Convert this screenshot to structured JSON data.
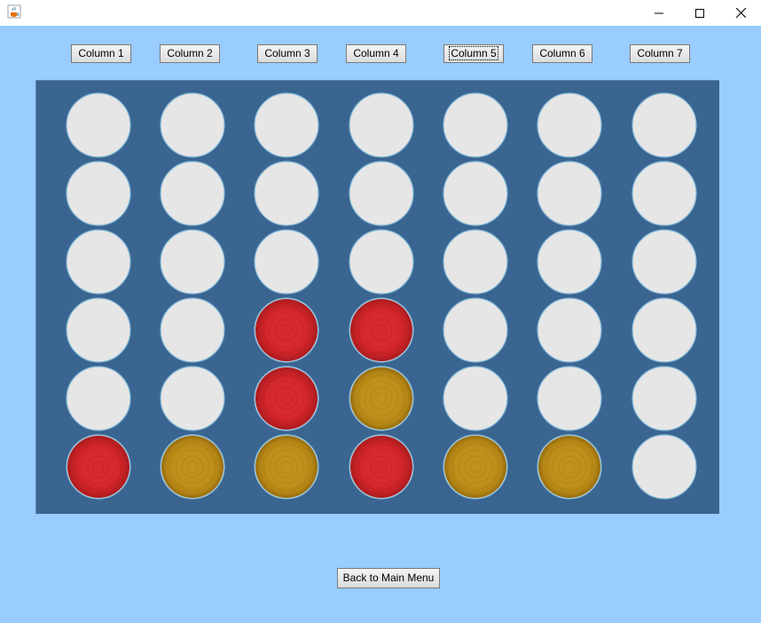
{
  "window": {
    "icon": "java-cup-icon",
    "controls": [
      "minimize-icon",
      "maximize-icon",
      "close-icon"
    ]
  },
  "columns": [
    {
      "label": "Column 1"
    },
    {
      "label": "Column 2"
    },
    {
      "label": "Column 3"
    },
    {
      "label": "Column 4"
    },
    {
      "label": "Column 5",
      "focused": true
    },
    {
      "label": "Column 6"
    },
    {
      "label": "Column 7"
    }
  ],
  "board": {
    "rows": 6,
    "cols": 7,
    "cells": [
      [
        "empty",
        "empty",
        "empty",
        "empty",
        "empty",
        "empty",
        "empty"
      ],
      [
        "empty",
        "empty",
        "empty",
        "empty",
        "empty",
        "empty",
        "empty"
      ],
      [
        "empty",
        "empty",
        "empty",
        "empty",
        "empty",
        "empty",
        "empty"
      ],
      [
        "empty",
        "empty",
        "red",
        "red",
        "empty",
        "empty",
        "empty"
      ],
      [
        "empty",
        "empty",
        "red",
        "yellow",
        "empty",
        "empty",
        "empty"
      ],
      [
        "red",
        "yellow",
        "yellow",
        "red",
        "yellow",
        "yellow",
        "empty"
      ]
    ]
  },
  "colors": {
    "background": "#99ccff",
    "board": "#3a6591",
    "empty": "#e6e6e6",
    "red": "#d8282c",
    "yellow": "#c0901a"
  },
  "back_button": {
    "label": "Back to Main Menu"
  }
}
